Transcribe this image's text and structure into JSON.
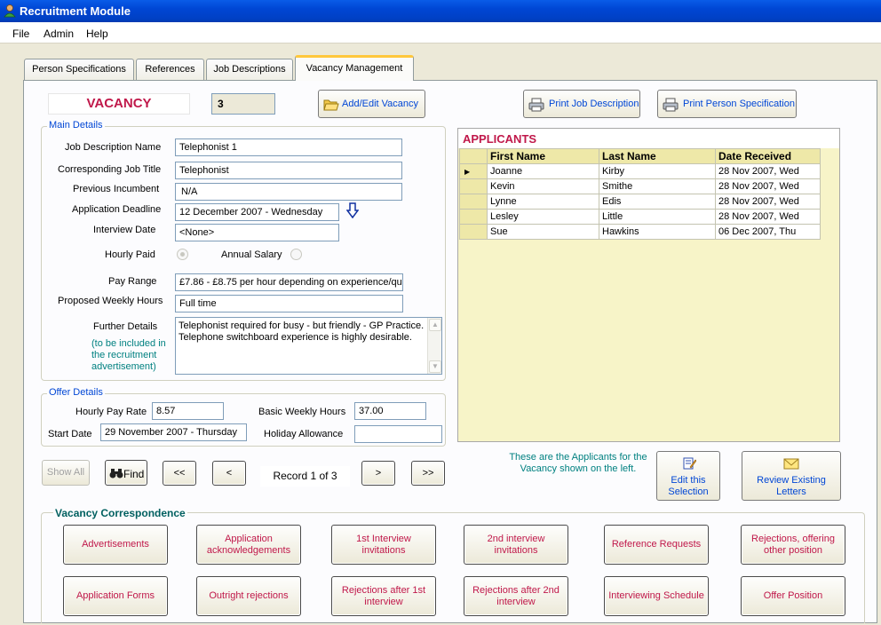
{
  "window": {
    "title": "Recruitment Module"
  },
  "menu": {
    "items": [
      "File",
      "Admin",
      "Help"
    ]
  },
  "tabs": [
    "Person Specifications",
    "References",
    "Job Descriptions",
    "Vacancy Management"
  ],
  "vacancy": {
    "label": "VACANCY",
    "number": "3"
  },
  "buttons": {
    "add_edit": "Add/Edit Vacancy",
    "print_job": "Print Job Description",
    "print_person": "Print Person Specification",
    "show_all": "Show All",
    "find": "Find",
    "first": "<<",
    "prev": "<",
    "next": ">",
    "last": ">>",
    "edit_selection": "Edit this Selection",
    "review_letters": "Review Existing Letters"
  },
  "main_details": {
    "title": "Main Details",
    "job_desc_label": "Job Description Name",
    "job_desc_value": "Telephonist 1",
    "corr_title_label": "Corresponding Job Title",
    "corr_title_value": "Telephonist",
    "prev_inc_label": "Previous Incumbent",
    "prev_inc_value": "N/A",
    "deadline_label": "Application Deadline",
    "deadline_value": "12 December 2007  -  Wednesday",
    "interview_label": "Interview Date",
    "interview_value": "<None>",
    "hourly_label": "Hourly Paid",
    "annual_label": "Annual Salary",
    "pay_range_label": "Pay Range",
    "pay_range_value": "£7.86 - £8.75 per hour depending on experience/qu",
    "weekly_hours_label": "Proposed Weekly Hours",
    "weekly_hours_value": "Full time",
    "further_label": "Further Details",
    "further_note": "(to be included in the recruitment advertisement)",
    "further_value": "Telephonist required for busy - but friendly - GP Practice. Telephone switchboard experience is highly desirable."
  },
  "offer_details": {
    "title": "Offer Details",
    "hourly_rate_label": "Hourly Pay Rate",
    "hourly_rate_value": "8.57",
    "basic_hours_label": "Basic Weekly Hours",
    "basic_hours_value": "37.00",
    "start_label": "Start Date",
    "start_value": "29 November 2007  -  Thursday",
    "holiday_label": "Holiday Allowance",
    "holiday_value": ""
  },
  "record": "Record 1 of 3",
  "applicants": {
    "title": "APPLICANTS",
    "columns": [
      "First Name",
      "Last Name",
      "Date Received"
    ],
    "rows": [
      [
        "Joanne",
        "Kirby",
        "28 Nov 2007, Wed"
      ],
      [
        "Kevin",
        "Smithe",
        "28 Nov 2007, Wed"
      ],
      [
        "Lynne",
        "Edis",
        "28 Nov 2007, Wed"
      ],
      [
        "Lesley",
        "Little",
        "28 Nov 2007, Wed"
      ],
      [
        "Sue",
        "Hawkins",
        "06 Dec 2007, Thu"
      ]
    ],
    "note": "These are the Applicants for the Vacancy shown on the left."
  },
  "correspondence": {
    "title": "Vacancy Correspondence",
    "buttons": [
      "Advertisements",
      "Application acknowledgements",
      "1st Interview invitations",
      "2nd interview invitations",
      "Reference Requests",
      "Rejections, offering other position",
      "Application Forms",
      "Outright rejections",
      "Rejections after 1st interview",
      "Rejections after 2nd interview",
      "Interviewing Schedule",
      "Offer Position"
    ]
  },
  "colors": {
    "titlebar": "#0046D4",
    "vacancy_red": "#C0184A",
    "group_blue": "#0046D5",
    "grid_yellow": "#F7F4C8",
    "note_teal": "#008080"
  }
}
